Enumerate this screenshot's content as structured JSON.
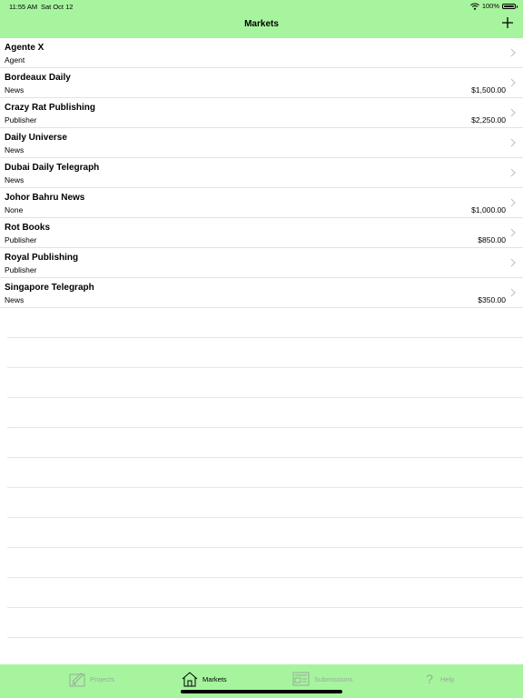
{
  "status_bar": {
    "time": "11:55 AM",
    "date": "Sat Oct 12",
    "battery": "100%"
  },
  "nav": {
    "title": "Markets",
    "add_icon": "plus-icon"
  },
  "markets": [
    {
      "name": "Agente X",
      "type": "Agent",
      "amount": ""
    },
    {
      "name": "Bordeaux Daily",
      "type": "News",
      "amount": "$1,500.00"
    },
    {
      "name": "Crazy Rat Publishing",
      "type": "Publisher",
      "amount": "$2,250.00"
    },
    {
      "name": "Daily Universe",
      "type": "News",
      "amount": ""
    },
    {
      "name": "Dubai Daily Telegraph",
      "type": "News",
      "amount": ""
    },
    {
      "name": "Johor Bahru News",
      "type": "None",
      "amount": "$1,000.00"
    },
    {
      "name": "Rot Books",
      "type": "Publisher",
      "amount": "$850.00"
    },
    {
      "name": "Royal Publishing",
      "type": "Publisher",
      "amount": ""
    },
    {
      "name": "Singapore Telegraph",
      "type": "News",
      "amount": "$350.00"
    }
  ],
  "tabs": [
    {
      "label": "Projects",
      "icon": "projects-icon",
      "selected": false
    },
    {
      "label": "Markets",
      "icon": "house-icon",
      "selected": true
    },
    {
      "label": "Submissions",
      "icon": "submissions-icon",
      "selected": false
    },
    {
      "label": "Help",
      "icon": "question-icon",
      "selected": false
    }
  ],
  "colors": {
    "bar": "#a6f59e",
    "separator": "#e2e2e2",
    "inactive_tab": "#9aa99a"
  }
}
